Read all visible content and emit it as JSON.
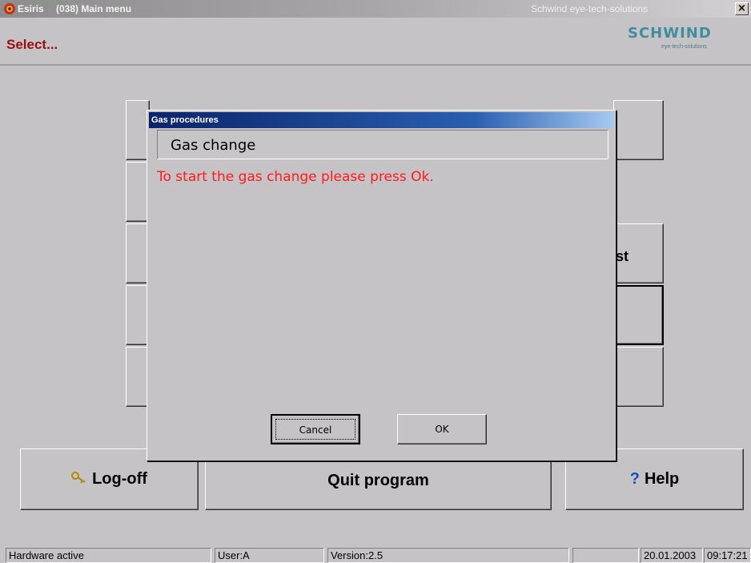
{
  "titlebar": {
    "app": "Esiris",
    "screen": "(038) Main menu",
    "vendor": "Schwind eye-tech-solutions",
    "close": "×"
  },
  "header": {
    "select": "Select...",
    "logo": "SCHWIND",
    "logo_sub": "eye-tech-solutions"
  },
  "menu": {
    "partial_label": "st"
  },
  "bottom": {
    "logoff": "Log-off",
    "quit": "Quit program",
    "help": "Help",
    "help_glyph": "?",
    "key_glyph": "🔑"
  },
  "dialog": {
    "title": "Gas procedures",
    "heading": "Gas change",
    "message": "To start the gas change please press Ok.",
    "cancel": "Cancel",
    "ok": "OK"
  },
  "status": {
    "hardware": "Hardware active",
    "user": "User:A",
    "version": "Version:2.5",
    "date": "20.01.2003",
    "time": "09:17:21"
  },
  "colors": {
    "accent_red": "#9a1010",
    "message_red": "#ff1a1a",
    "dialog_title_blue": "#0a246a",
    "logo_teal": "#3f8ea0"
  },
  "icons": {
    "app": "esiris-app-icon",
    "logoff": "key-icon",
    "help": "question-icon",
    "close": "close-icon"
  }
}
